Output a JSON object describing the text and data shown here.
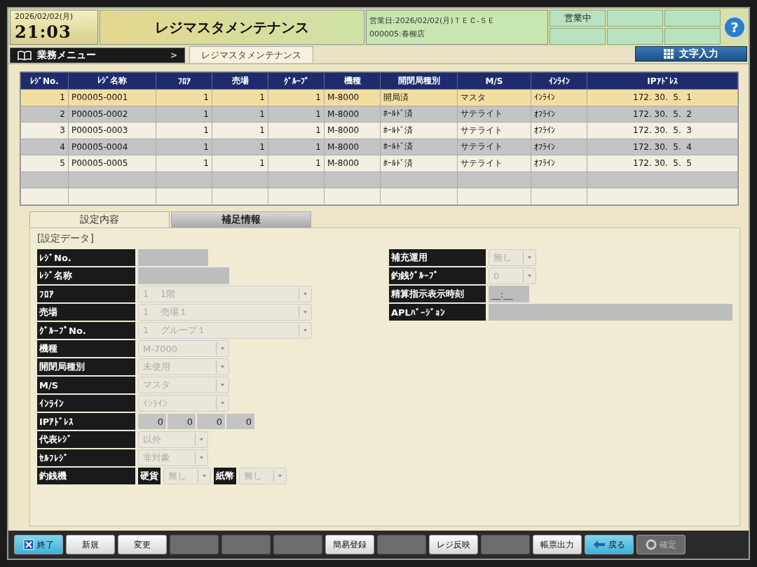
{
  "header": {
    "date": "2026/02/02(月)",
    "time": "21:03",
    "title": "レジマスタメンテナンス",
    "business_date": "営業日:2026/02/02(月)ＴＥＣ-ＳＥ",
    "store": "000005:春柳店",
    "status": "営業中",
    "help": "?"
  },
  "nav": {
    "menu": "業務メニュー",
    "menu_arrow": ">",
    "tab": "レジマスタメンテナンス",
    "text_input": "文字入力"
  },
  "table": {
    "columns": [
      "ﾚｼﾞNo.",
      "ﾚｼﾞ名称",
      "ﾌﾛｱ",
      "売場",
      "ｸﾞﾙｰﾌﾟ",
      "機種",
      "開閉局種別",
      "M/S",
      "ｲﾝﾗｲﾝ",
      "IPｱﾄﾞﾚｽ"
    ],
    "rows": [
      {
        "selected": true,
        "cells": [
          "1",
          "P00005-0001",
          "1",
          "1",
          "1",
          "M-8000",
          "開局済",
          "マスタ",
          "ｲﾝﾗｲﾝ",
          "172. 30.  5.  1"
        ]
      },
      {
        "selected": false,
        "cells": [
          "2",
          "P00005-0002",
          "1",
          "1",
          "1",
          "M-8000",
          "ﾎｰﾙﾄﾞ済",
          "サテライト",
          "ｵﾌﾗｲﾝ",
          "172. 30.  5.  2"
        ]
      },
      {
        "selected": false,
        "cells": [
          "3",
          "P00005-0003",
          "1",
          "1",
          "1",
          "M-8000",
          "ﾎｰﾙﾄﾞ済",
          "サテライト",
          "ｵﾌﾗｲﾝ",
          "172. 30.  5.  3"
        ]
      },
      {
        "selected": false,
        "cells": [
          "4",
          "P00005-0004",
          "1",
          "1",
          "1",
          "M-8000",
          "ﾎｰﾙﾄﾞ済",
          "サテライト",
          "ｵﾌﾗｲﾝ",
          "172. 30.  5.  4"
        ]
      },
      {
        "selected": false,
        "cells": [
          "5",
          "P00005-0005",
          "1",
          "1",
          "1",
          "M-8000",
          "ﾎｰﾙﾄﾞ済",
          "サテライト",
          "ｵﾌﾗｲﾝ",
          "172. 30.  5.  5"
        ]
      }
    ]
  },
  "tabs": [
    {
      "label": "設定内容",
      "selected": true
    },
    {
      "label": "補足情報",
      "selected": false
    }
  ],
  "section_title": "[設定データ]",
  "left_fields": [
    {
      "label": "ﾚｼﾞNo.",
      "kind": "blank"
    },
    {
      "label": "ﾚｼﾞ名称",
      "kind": "blank"
    },
    {
      "label": "ﾌﾛｱ",
      "kind": "select",
      "code": "1",
      "value": "1階"
    },
    {
      "label": "売場",
      "kind": "select",
      "code": "1",
      "value": "売場１"
    },
    {
      "label": "ｸﾞﾙｰﾌﾟNo.",
      "kind": "select",
      "code": "1",
      "value": "グループ１"
    },
    {
      "label": "機種",
      "kind": "select",
      "value": "M-7000"
    },
    {
      "label": "開閉局種別",
      "kind": "select",
      "value": "未使用"
    },
    {
      "label": "M/S",
      "kind": "select",
      "value": "マスタ"
    },
    {
      "label": "ｲﾝﾗｲﾝ",
      "kind": "select",
      "value": "ｲﾝﾗｲﾝ"
    },
    {
      "label": "IPｱﾄﾞﾚｽ",
      "kind": "ip",
      "parts": [
        "0",
        "0",
        "0",
        "0"
      ]
    },
    {
      "label": "代表ﾚｼﾞ",
      "kind": "select",
      "value": "以外"
    },
    {
      "label": "ｾﾙﾌﾚｼﾞ",
      "kind": "select",
      "value": "非対象"
    },
    {
      "label": "釣銭機",
      "kind": "pair",
      "items": [
        {
          "label": "硬貨",
          "value": "無し"
        },
        {
          "label": "紙幣",
          "value": "無し"
        }
      ]
    }
  ],
  "right_fields": [
    {
      "label": "補充運用",
      "kind": "select",
      "value": "無し"
    },
    {
      "label": "釣銭ｸﾞﾙｰﾌﾟ",
      "kind": "select",
      "value": "0"
    },
    {
      "label": "精算指示表示時刻",
      "kind": "time",
      "value": "__:__"
    },
    {
      "label": "APLﾊﾞｰｼﾞｮﾝ",
      "kind": "blank"
    }
  ],
  "buttons": [
    {
      "kind": "exit",
      "label": "終了"
    },
    {
      "kind": "normal",
      "label": "新規"
    },
    {
      "kind": "normal",
      "label": "変更"
    },
    {
      "kind": "blank"
    },
    {
      "kind": "blank"
    },
    {
      "kind": "blank"
    },
    {
      "kind": "normal",
      "label": "簡易登録"
    },
    {
      "kind": "blank"
    },
    {
      "kind": "normal",
      "label": "レジ反映"
    },
    {
      "kind": "blank"
    },
    {
      "kind": "normal",
      "label": "帳票出力"
    },
    {
      "kind": "back",
      "label": "戻る"
    },
    {
      "kind": "disabled",
      "label": "確定"
    }
  ]
}
